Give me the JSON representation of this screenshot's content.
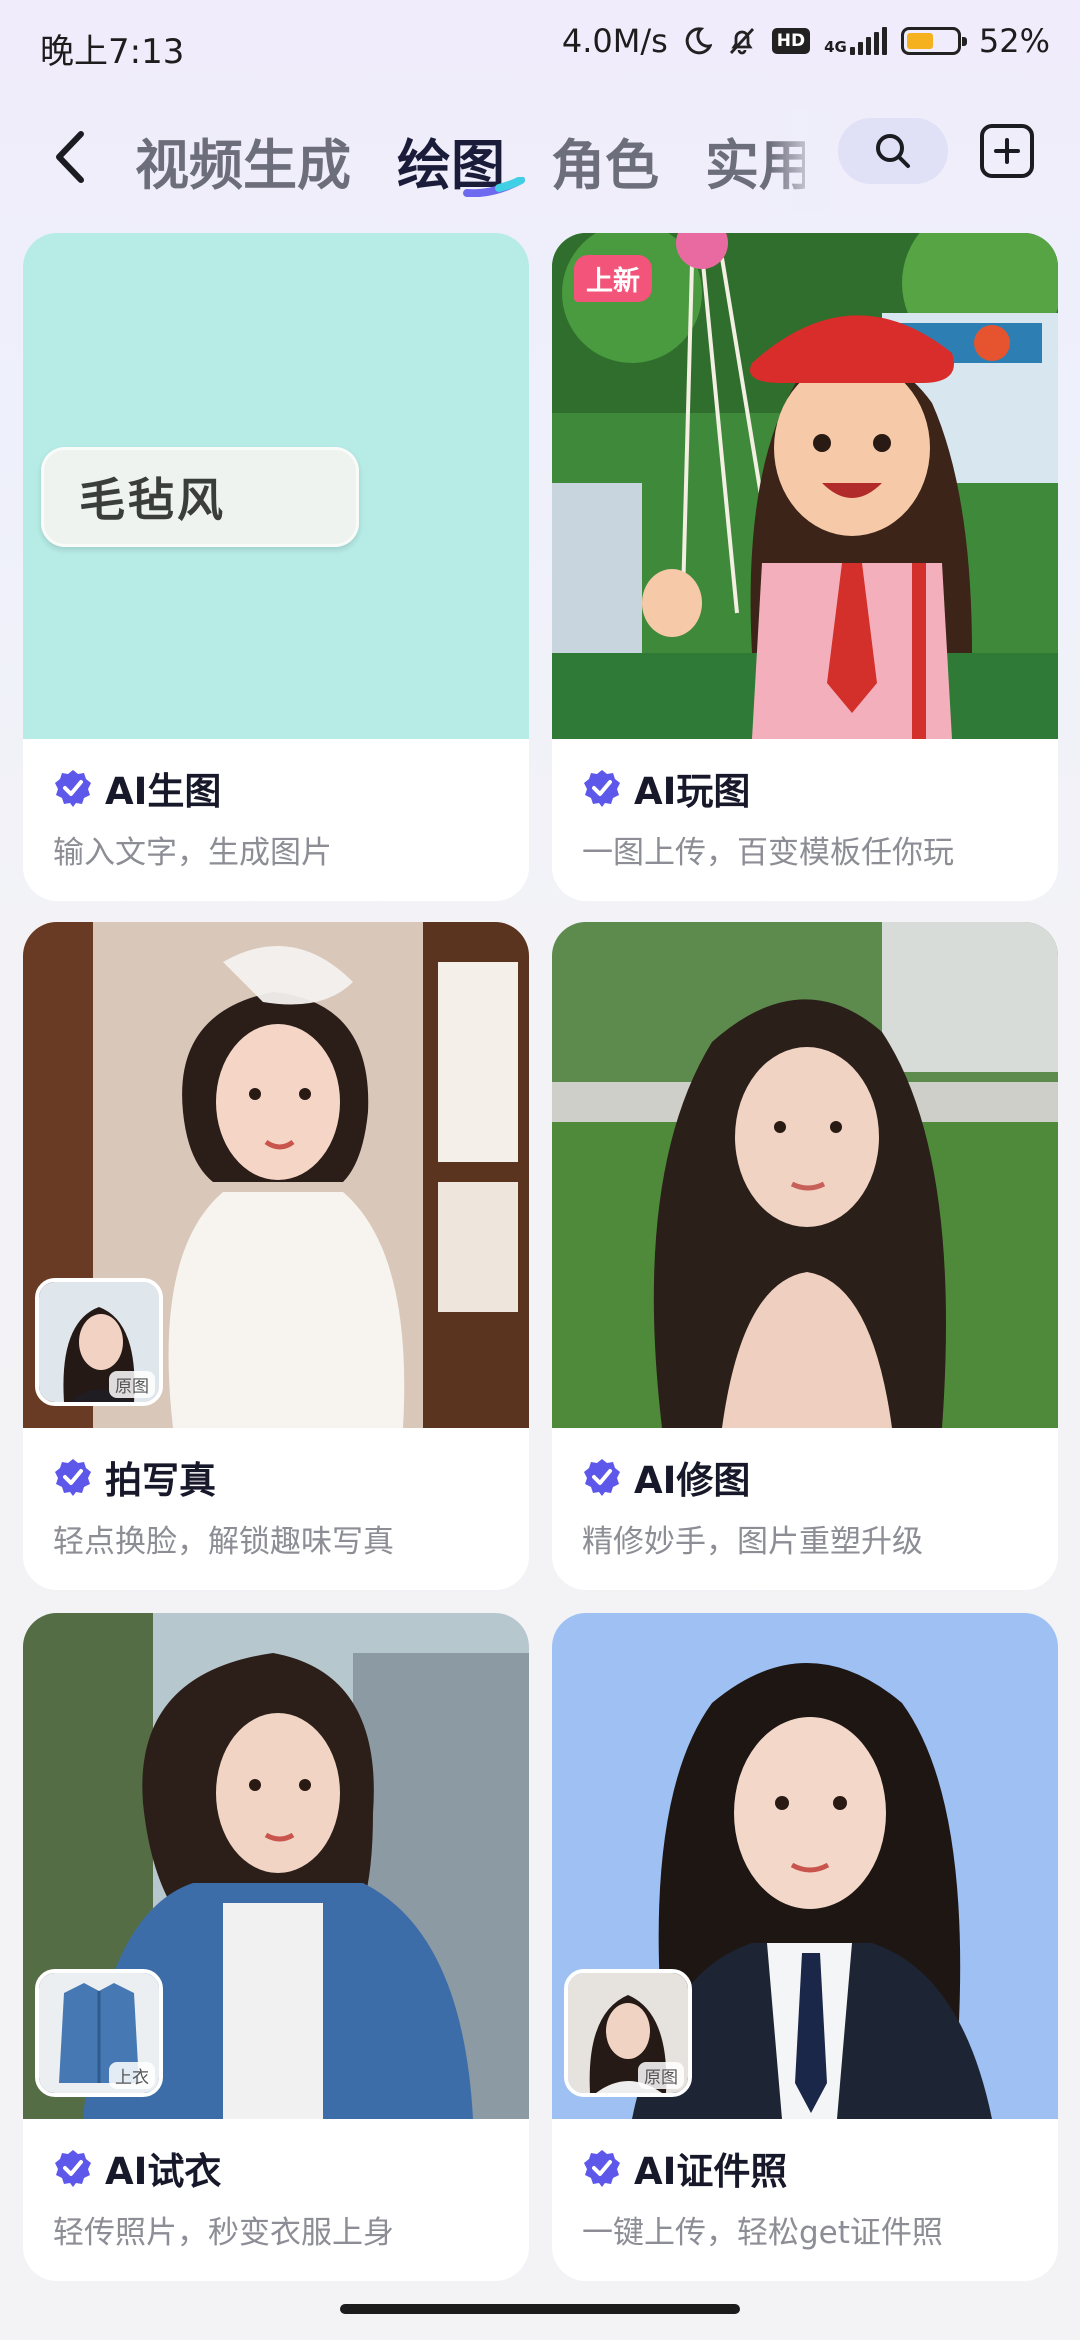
{
  "status_bar": {
    "time": "晚上7:13",
    "net_speed": "4.0M/s",
    "hd": "HD",
    "network": "4G",
    "battery_percent": "52%",
    "battery_level": 0.52
  },
  "nav": {
    "back_icon": "chevron-left-icon",
    "tabs": [
      {
        "label": "视频生成",
        "active": false
      },
      {
        "label": "绘图",
        "active": true
      },
      {
        "label": "角色",
        "active": false
      },
      {
        "label": "实用",
        "active": false
      }
    ],
    "search_icon": "search-icon",
    "add_icon": "plus-square-icon",
    "accent_color": "#5b57e8"
  },
  "cards": [
    {
      "title": "AI生图",
      "subtitle": "输入文字，生成图片",
      "overlay_text": "毛毡风"
    },
    {
      "title": "AI玩图",
      "subtitle": "一图上传，百变模板任你玩",
      "badge": "上新"
    },
    {
      "title": "拍写真",
      "subtitle": "轻点换脸，解锁趣味写真",
      "thumb_label": "原图"
    },
    {
      "title": "AI修图",
      "subtitle": "精修妙手，图片重塑升级"
    },
    {
      "title": "AI试衣",
      "subtitle": "轻传照片，秒变衣服上身",
      "thumb_label": "上衣"
    },
    {
      "title": "AI证件照",
      "subtitle": "一键上传，轻松get证件照",
      "thumb_label": "原图"
    }
  ]
}
